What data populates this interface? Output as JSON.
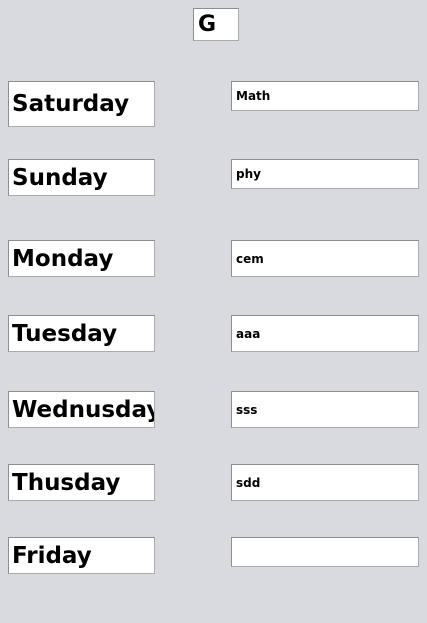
{
  "header": {
    "letter": "G"
  },
  "days": [
    {
      "label": "Saturday",
      "subject": "Math"
    },
    {
      "label": "Sunday",
      "subject": "phy"
    },
    {
      "label": "Monday",
      "subject": "cem"
    },
    {
      "label": "Tuesday",
      "subject": "aaa"
    },
    {
      "label": "Wednusday",
      "subject": "sss"
    },
    {
      "label": "Thusday",
      "subject": "sdd"
    },
    {
      "label": "Friday",
      "subject": ""
    }
  ]
}
